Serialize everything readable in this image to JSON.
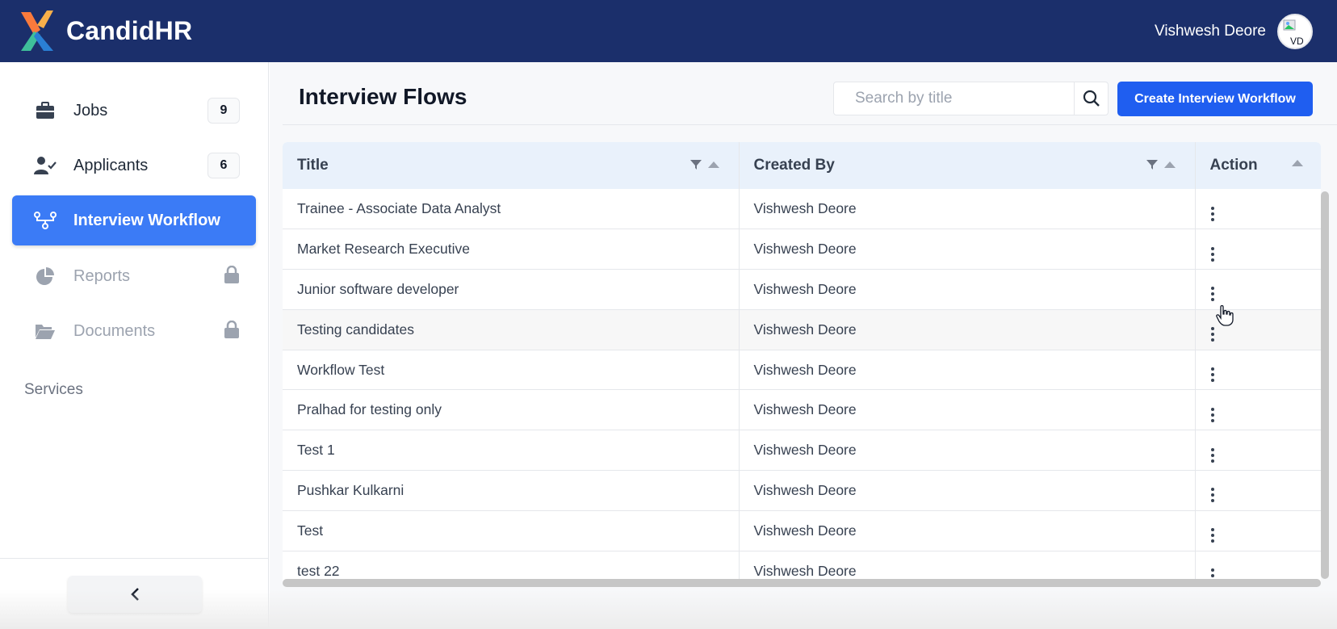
{
  "header": {
    "brand": "CandidHR",
    "user_name": "Vishwesh Deore",
    "avatar_alt": "VD",
    "bg_color": "#1b2f6b"
  },
  "sidebar": {
    "items": [
      {
        "label": "Jobs",
        "icon": "briefcase-icon",
        "badge": "9",
        "state": "normal"
      },
      {
        "label": "Applicants",
        "icon": "user-check-icon",
        "badge": "6",
        "state": "normal"
      },
      {
        "label": "Interview Workflow",
        "icon": "workflow-icon",
        "badge": "",
        "state": "active"
      },
      {
        "label": "Reports",
        "icon": "pie-chart-icon",
        "badge": "",
        "state": "locked"
      },
      {
        "label": "Documents",
        "icon": "folder-open-icon",
        "badge": "",
        "state": "locked"
      }
    ],
    "services_label": "Services",
    "collapse_icon": "chevron-left-icon",
    "active_color": "#3b7bf6"
  },
  "main": {
    "title": "Interview Flows",
    "search_placeholder": "Search by title",
    "create_label": "Create Interview Workflow",
    "create_color": "#1f5ef0",
    "table": {
      "columns": [
        "Title",
        "Created By",
        "Action"
      ],
      "rows": [
        {
          "title": "Trainee - Associate Data Analyst",
          "created_by": "Vishwesh Deore"
        },
        {
          "title": "Market Research Executive",
          "created_by": "Vishwesh Deore"
        },
        {
          "title": "Junior software developer",
          "created_by": "Vishwesh Deore"
        },
        {
          "title": "Testing candidates",
          "created_by": "Vishwesh Deore"
        },
        {
          "title": "Workflow Test",
          "created_by": "Vishwesh Deore"
        },
        {
          "title": "Pralhad for testing only",
          "created_by": "Vishwesh Deore"
        },
        {
          "title": "Test 1",
          "created_by": "Vishwesh Deore"
        },
        {
          "title": "Pushkar Kulkarni",
          "created_by": "Vishwesh Deore"
        },
        {
          "title": "Test",
          "created_by": "Vishwesh Deore"
        },
        {
          "title": "test 22",
          "created_by": "Vishwesh Deore"
        }
      ]
    }
  }
}
